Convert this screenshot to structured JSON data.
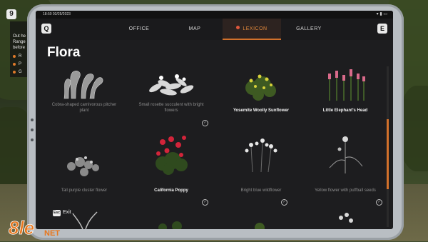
{
  "hud": {
    "level_badge": "9",
    "lines": [
      "Out he",
      "Range",
      "before"
    ],
    "items": [
      "R",
      "P",
      "G"
    ]
  },
  "status": {
    "time": "18:50  03/25/2023",
    "icons": "▾ ▮ ▭"
  },
  "nav": {
    "left_key": "Q",
    "right_key": "E",
    "tabs": [
      {
        "label": "OFFICE",
        "active": false
      },
      {
        "label": "MAP",
        "active": false
      },
      {
        "label": "LEXICON",
        "active": true
      },
      {
        "label": "GALLERY",
        "active": false
      }
    ]
  },
  "page": {
    "title": "Flora"
  },
  "cards": [
    {
      "label": "Cobra-shaped carnivorous pitcher plant",
      "known": false,
      "checked": false
    },
    {
      "label": "Small rosette succulent with bright flowers",
      "known": false,
      "checked": true
    },
    {
      "label": "Yosemite Woolly Sunflower",
      "known": true,
      "checked": false
    },
    {
      "label": "Little Elephant's Head",
      "known": true,
      "checked": false
    },
    {
      "label": "Tall purple cluster flower",
      "known": false,
      "checked": false
    },
    {
      "label": "California Poppy",
      "known": true,
      "checked": true
    },
    {
      "label": "Bright blue wildflower",
      "known": false,
      "checked": true
    },
    {
      "label": "Yellow flower with puffball seeds",
      "known": false,
      "checked": true
    }
  ],
  "footer": {
    "exit_key": "Esc",
    "exit_label": "Exit"
  },
  "watermark": {
    "text": "8le",
    "sub": "NET"
  },
  "colors": {
    "accent": "#d2712b",
    "active_tab_dot": "#e0573c",
    "screen_bg": "#1d1d1f"
  }
}
